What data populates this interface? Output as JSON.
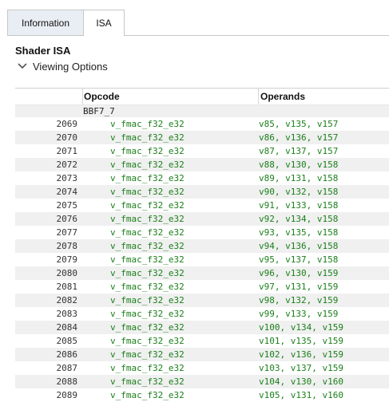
{
  "tabs": [
    {
      "label": "Information",
      "active": false
    },
    {
      "label": "ISA",
      "active": true
    }
  ],
  "section_title": "Shader ISA",
  "viewing_options_label": "Viewing Options",
  "table": {
    "headers": {
      "opcode": "Opcode",
      "operands": "Operands"
    },
    "block_label": "BBF7_7",
    "rows": [
      {
        "line": "2069",
        "opcode": "v_fmac_f32_e32",
        "operands": "v85, v135, v157"
      },
      {
        "line": "2070",
        "opcode": "v_fmac_f32_e32",
        "operands": "v86, v136, v157"
      },
      {
        "line": "2071",
        "opcode": "v_fmac_f32_e32",
        "operands": "v87, v137, v157"
      },
      {
        "line": "2072",
        "opcode": "v_fmac_f32_e32",
        "operands": "v88, v130, v158"
      },
      {
        "line": "2073",
        "opcode": "v_fmac_f32_e32",
        "operands": "v89, v131, v158"
      },
      {
        "line": "2074",
        "opcode": "v_fmac_f32_e32",
        "operands": "v90, v132, v158"
      },
      {
        "line": "2075",
        "opcode": "v_fmac_f32_e32",
        "operands": "v91, v133, v158"
      },
      {
        "line": "2076",
        "opcode": "v_fmac_f32_e32",
        "operands": "v92, v134, v158"
      },
      {
        "line": "2077",
        "opcode": "v_fmac_f32_e32",
        "operands": "v93, v135, v158"
      },
      {
        "line": "2078",
        "opcode": "v_fmac_f32_e32",
        "operands": "v94, v136, v158"
      },
      {
        "line": "2079",
        "opcode": "v_fmac_f32_e32",
        "operands": "v95, v137, v158"
      },
      {
        "line": "2080",
        "opcode": "v_fmac_f32_e32",
        "operands": "v96, v130, v159"
      },
      {
        "line": "2081",
        "opcode": "v_fmac_f32_e32",
        "operands": "v97, v131, v159"
      },
      {
        "line": "2082",
        "opcode": "v_fmac_f32_e32",
        "operands": "v98, v132, v159"
      },
      {
        "line": "2083",
        "opcode": "v_fmac_f32_e32",
        "operands": "v99, v133, v159"
      },
      {
        "line": "2084",
        "opcode": "v_fmac_f32_e32",
        "operands": "v100, v134, v159"
      },
      {
        "line": "2085",
        "opcode": "v_fmac_f32_e32",
        "operands": "v101, v135, v159"
      },
      {
        "line": "2086",
        "opcode": "v_fmac_f32_e32",
        "operands": "v102, v136, v159"
      },
      {
        "line": "2087",
        "opcode": "v_fmac_f32_e32",
        "operands": "v103, v137, v159"
      },
      {
        "line": "2088",
        "opcode": "v_fmac_f32_e32",
        "operands": "v104, v130, v160"
      },
      {
        "line": "2089",
        "opcode": "v_fmac_f32_e32",
        "operands": "v105, v131, v160"
      }
    ]
  },
  "colors": {
    "instruction_text": "#1a7f1a",
    "tab_inactive_bg": "#e9eef4",
    "row_alt_bg": "#f0f0f0"
  },
  "icons": {
    "viewing_options": "chevron-down-icon"
  }
}
